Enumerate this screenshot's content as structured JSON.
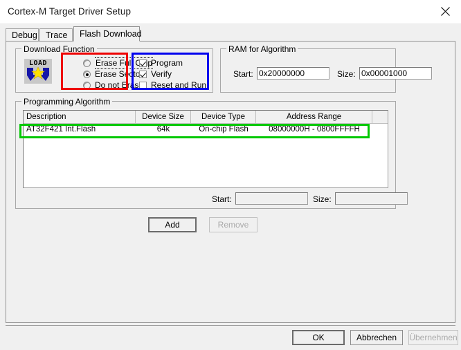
{
  "window": {
    "title": "Cortex-M Target Driver Setup",
    "close_icon": "close-icon"
  },
  "tabs": [
    {
      "label": "Debug",
      "active": false
    },
    {
      "label": "Trace",
      "active": false
    },
    {
      "label": "Flash Download",
      "active": true
    }
  ],
  "download_function": {
    "group_title": "Download Function",
    "icon_label": "LOAD",
    "erase_options": [
      {
        "label": "Erase Full Chip",
        "selected": false,
        "focused": true
      },
      {
        "label": "Erase Sectors",
        "selected": true,
        "focused": false
      },
      {
        "label": "Do not Erase",
        "selected": false,
        "focused": false
      }
    ],
    "action_options": [
      {
        "label": "Program",
        "checked": true
      },
      {
        "label": "Verify",
        "checked": true
      },
      {
        "label": "Reset and Run",
        "checked": false
      }
    ]
  },
  "ram_for_algorithm": {
    "group_title": "RAM for Algorithm",
    "start_label": "Start:",
    "start_value": "0x20000000",
    "size_label": "Size:",
    "size_value": "0x00001000"
  },
  "programming_algorithm": {
    "group_title": "Programming Algorithm",
    "columns": [
      "Description",
      "Device Size",
      "Device Type",
      "Address Range",
      ""
    ],
    "rows": [
      {
        "description": "AT32F421 Int.Flash",
        "device_size": "64k",
        "device_type": "On-chip Flash",
        "address_range": "08000000H - 0800FFFFH",
        "extra": "",
        "highlighted": true
      }
    ],
    "start_label": "Start:",
    "start_value": "",
    "size_label": "Size:",
    "size_value": "",
    "add_button": "Add",
    "remove_button": "Remove"
  },
  "footer": {
    "ok_button": "OK",
    "cancel_button": "Abbrechen",
    "apply_button": "Übernehmen"
  },
  "annotations": {
    "red_color": "#ee0000",
    "blue_color": "#0000ee",
    "green_color": "#00c800"
  }
}
